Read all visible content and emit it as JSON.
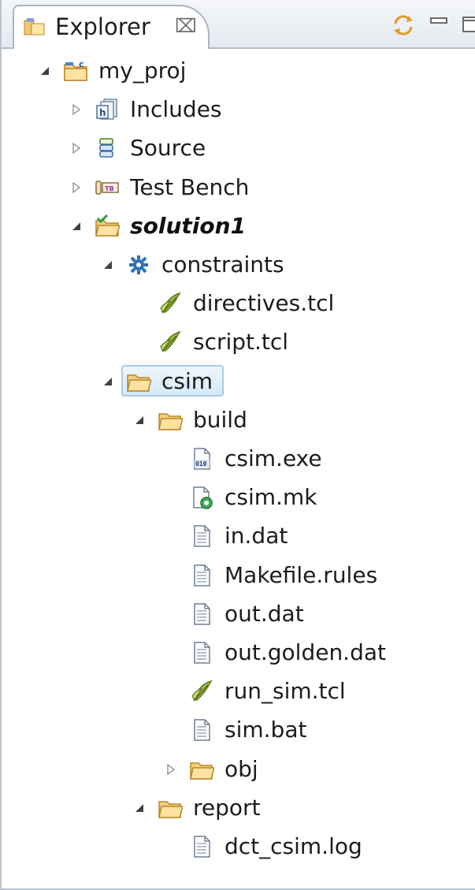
{
  "view": {
    "title": "Explorer",
    "close_glyph": "⌧",
    "toolbar_icons": [
      "sync-icon",
      "minimize-icon",
      "maximize-icon"
    ]
  },
  "tree": [
    {
      "label": "my_proj",
      "indent": 0,
      "expander": "expanded",
      "icon": "c-project-icon",
      "bold": false
    },
    {
      "label": "Includes",
      "indent": 1,
      "expander": "collapsed",
      "icon": "includes-icon",
      "bold": false
    },
    {
      "label": "Source",
      "indent": 1,
      "expander": "collapsed",
      "icon": "source-icon",
      "bold": false
    },
    {
      "label": "Test Bench",
      "indent": 1,
      "expander": "collapsed",
      "icon": "test-bench-icon",
      "bold": false
    },
    {
      "label": "solution1",
      "indent": 1,
      "expander": "expanded",
      "icon": "solution-folder-icon",
      "bold": true
    },
    {
      "label": "constraints",
      "indent": 2,
      "expander": "expanded",
      "icon": "constraints-icon",
      "bold": false
    },
    {
      "label": "directives.tcl",
      "indent": 3,
      "expander": "none",
      "icon": "tcl-script-icon",
      "bold": false
    },
    {
      "label": "script.tcl",
      "indent": 3,
      "expander": "none",
      "icon": "tcl-script-icon",
      "bold": false
    },
    {
      "label": "csim",
      "indent": 2,
      "expander": "expanded",
      "icon": "folder-icon",
      "bold": false,
      "selected": true
    },
    {
      "label": "build",
      "indent": 3,
      "expander": "expanded",
      "icon": "folder-icon",
      "bold": false
    },
    {
      "label": "csim.exe",
      "indent": 4,
      "expander": "none",
      "icon": "binary-file-icon",
      "bold": false
    },
    {
      "label": "csim.mk",
      "indent": 4,
      "expander": "none",
      "icon": "makefile-icon",
      "bold": false
    },
    {
      "label": "in.dat",
      "indent": 4,
      "expander": "none",
      "icon": "text-file-icon",
      "bold": false
    },
    {
      "label": "Makefile.rules",
      "indent": 4,
      "expander": "none",
      "icon": "text-file-icon",
      "bold": false
    },
    {
      "label": "out.dat",
      "indent": 4,
      "expander": "none",
      "icon": "text-file-icon",
      "bold": false
    },
    {
      "label": "out.golden.dat",
      "indent": 4,
      "expander": "none",
      "icon": "text-file-icon",
      "bold": false
    },
    {
      "label": "run_sim.tcl",
      "indent": 4,
      "expander": "none",
      "icon": "tcl-script-icon",
      "bold": false
    },
    {
      "label": "sim.bat",
      "indent": 4,
      "expander": "none",
      "icon": "text-file-icon",
      "bold": false
    },
    {
      "label": "obj",
      "indent": 4,
      "expander": "collapsed",
      "icon": "folder-icon",
      "bold": false
    },
    {
      "label": "report",
      "indent": 3,
      "expander": "expanded",
      "icon": "folder-icon",
      "bold": false
    },
    {
      "label": "dct_csim.log",
      "indent": 4,
      "expander": "none",
      "icon": "text-file-icon",
      "bold": false
    }
  ],
  "colors": {
    "selection_border": "#a9cbe8",
    "selection_fill": "#d6e9f8",
    "folder": "#f2c469",
    "header": "#e5e9ef"
  }
}
